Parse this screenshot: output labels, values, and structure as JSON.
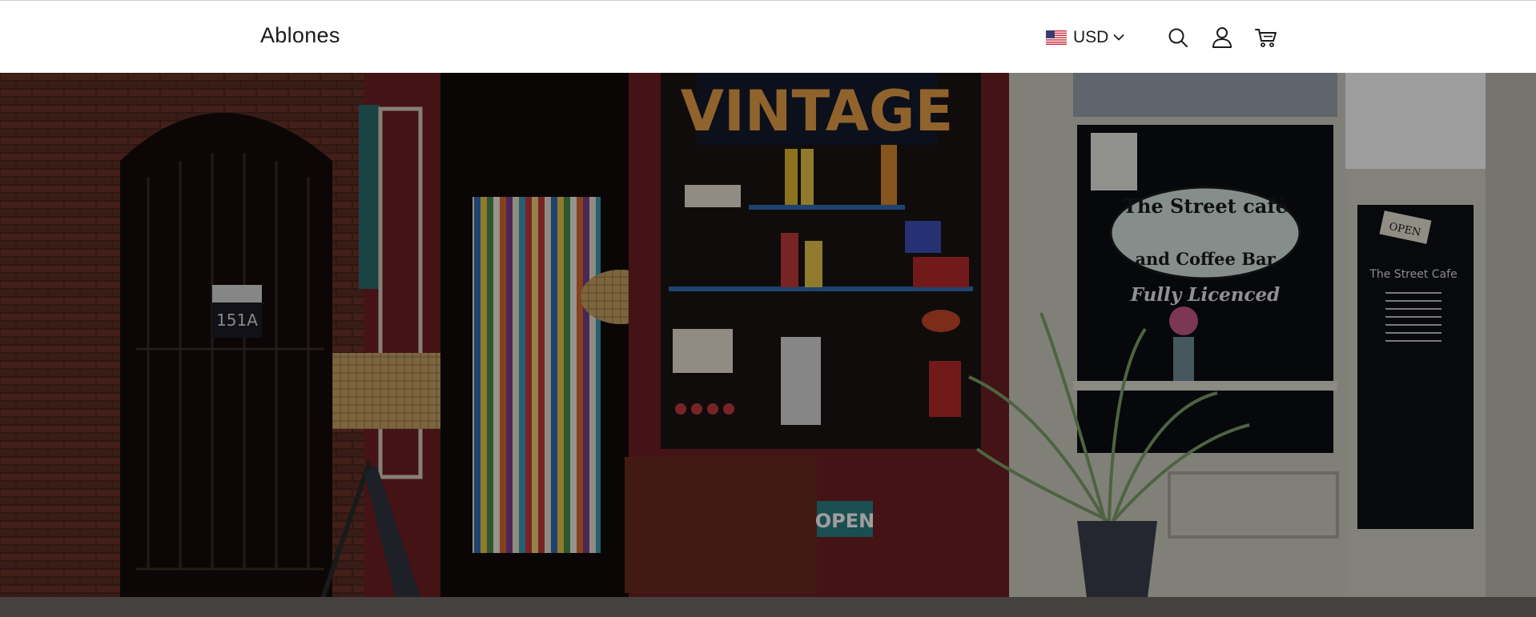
{
  "header": {
    "brand": "Ablones",
    "currency": {
      "code": "USD",
      "flag_icon": "us-flag-icon"
    },
    "icons": [
      "search-icon",
      "account-icon",
      "cart-icon"
    ]
  },
  "hero": {
    "sign_vintage": "VINTAGE",
    "cafe_line1": "The Street café",
    "cafe_line2": "and Coffee Bar",
    "cafe_tag": "Fully Licenced",
    "open_sign": "OPEN",
    "door_sign": "OPEN",
    "door_number": "151A",
    "door_cafe_title": "The Street Cafe",
    "overlay_color": "#000000"
  },
  "colors": {
    "header_bg": "#ffffff",
    "text": "#1a1a1a",
    "brick": "#5a2a22",
    "shopfront_red": "#6e1f22",
    "cafe_cream": "#cfcfc2"
  }
}
